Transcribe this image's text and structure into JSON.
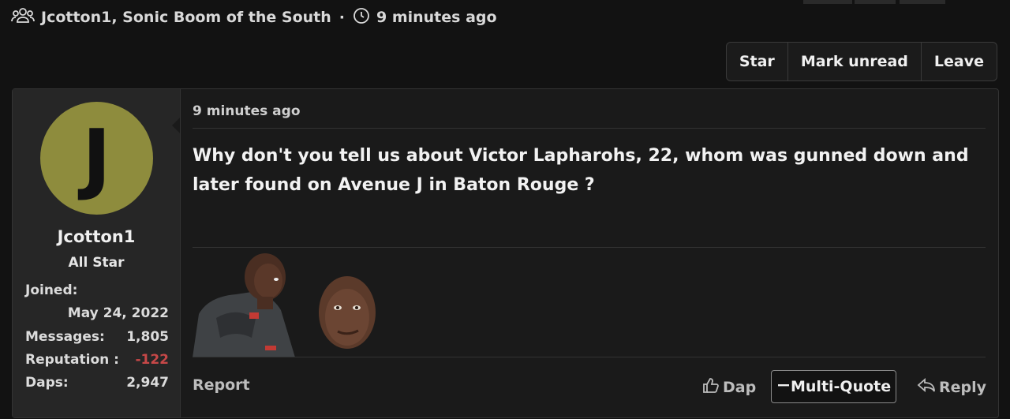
{
  "thread": {
    "participants": "Jcotton1, Sonic Boom of the South",
    "separator": "·",
    "time": "9 minutes ago"
  },
  "actions": {
    "star": "Star",
    "mark_unread": "Mark unread",
    "leave": "Leave"
  },
  "user": {
    "avatar_letter": "J",
    "name": "Jcotton1",
    "title": "All Star",
    "joined_label": "Joined:",
    "joined_value": "May 24, 2022",
    "messages_label": "Messages:",
    "messages_value": "1,805",
    "reputation_label": "Reputation :",
    "reputation_value": "-122",
    "daps_label": "Daps:",
    "daps_value": "2,947"
  },
  "post": {
    "time": "9 minutes ago",
    "message": "Why don't you tell us about Victor Lapharohs, 22, whom was gunned down and later found on Avenue J in Baton Rouge ?"
  },
  "footer": {
    "report": "Report",
    "dap": "Dap",
    "multi_quote": "Multi-Quote",
    "reply": "Reply"
  },
  "colors": {
    "avatar_bg": "#8e8c3d",
    "negative": "#c74848"
  }
}
